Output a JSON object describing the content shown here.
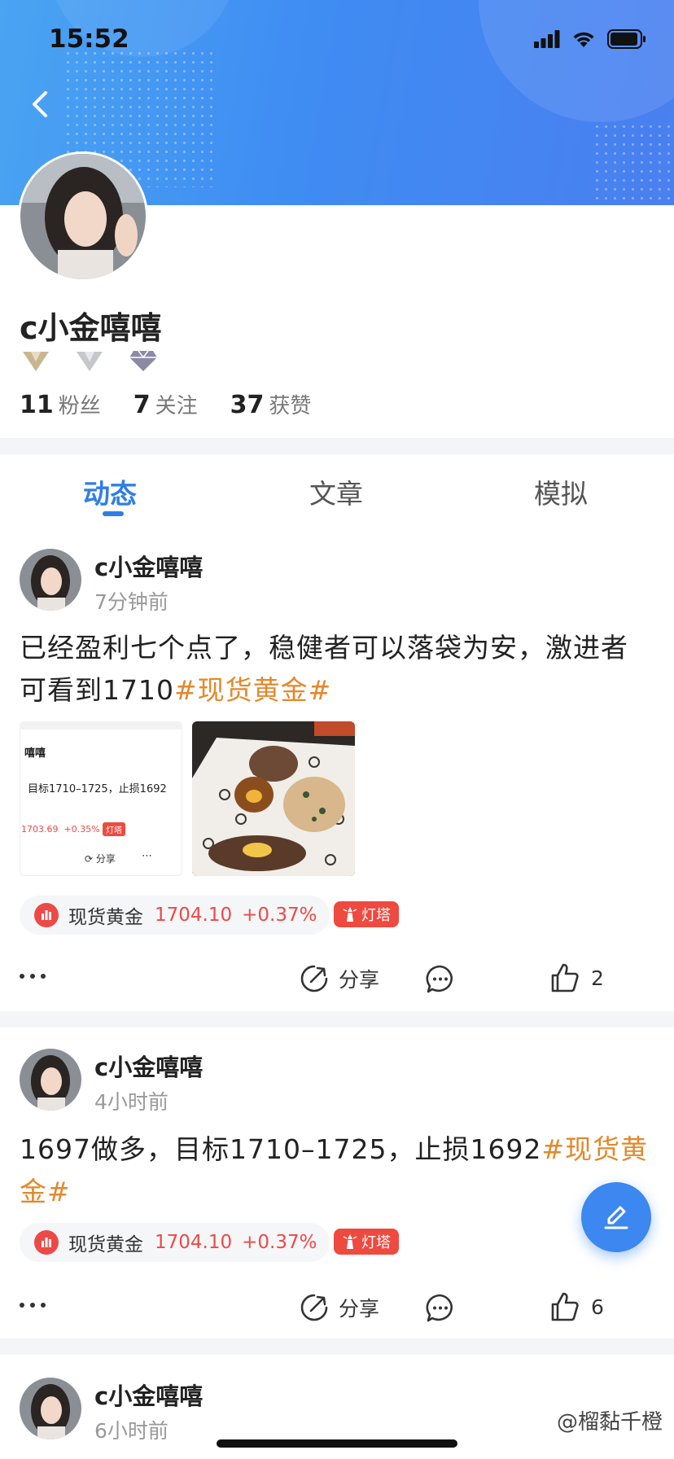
{
  "status_bar": {
    "time": "15:52"
  },
  "profile": {
    "name": "c小金嘻嘻",
    "badges": [
      "level-badge-gold",
      "level-badge-silver",
      "level-badge-diamond"
    ],
    "stats": [
      {
        "value": "11",
        "label": "粉丝"
      },
      {
        "value": "7",
        "label": "关注"
      },
      {
        "value": "37",
        "label": "获赞"
      }
    ]
  },
  "tabs": [
    {
      "label": "动态",
      "active": true
    },
    {
      "label": "文章",
      "active": false
    },
    {
      "label": "模拟",
      "active": false
    }
  ],
  "posts": [
    {
      "author": "c小金嘻嘻",
      "time": "7分钟前",
      "text": "已经盈利七个点了，稳健者可以落袋为安，激进者可看到1710",
      "hashtag": "#现货黄金#",
      "image1": {
        "name": "嘻嘻",
        "text": "目标1710–1725，止损1692",
        "price": "1703.69",
        "change": "+0.35%",
        "tag": "灯塔",
        "share": "分享"
      },
      "stock": {
        "name": "现货黄金",
        "price": "1704.10",
        "change": "+0.37%"
      },
      "tag": "灯塔",
      "share_label": "分享",
      "likes": "2"
    },
    {
      "author": "c小金嘻嘻",
      "time": "4小时前",
      "text": "1697做多，目标1710–1725，止损1692",
      "hashtag": "#现货黄金#",
      "stock": {
        "name": "现货黄金",
        "price": "1704.10",
        "change": "+0.37%"
      },
      "tag": "灯塔",
      "share_label": "分享",
      "likes": "6"
    },
    {
      "author": "c小金嘻嘻",
      "time": "6小时前"
    }
  ],
  "watermark": "@榴黏千橙",
  "colors": {
    "accent": "#2f7ee6",
    "hashtag": "#e4882a",
    "up": "#ec4a46",
    "header": "#4a90f0"
  }
}
